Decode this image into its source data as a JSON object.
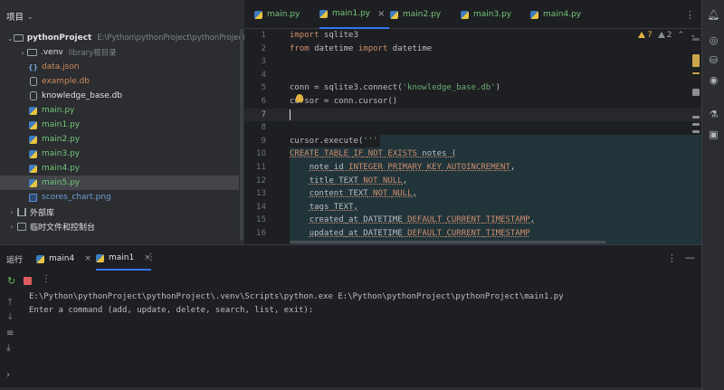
{
  "project_panel": {
    "title": "项目",
    "tree": [
      {
        "label": "pythonProject",
        "hint": "E:\\Python\\pythonProject\\pythonProject",
        "kind": "root"
      },
      {
        "label": ".venv",
        "hint": "library根目录",
        "kind": "folder"
      },
      {
        "label": "data.json",
        "kind": "json"
      },
      {
        "label": "example.db",
        "kind": "db"
      },
      {
        "label": "knowledge_base.db",
        "kind": "db-white"
      },
      {
        "label": "main.py",
        "kind": "py"
      },
      {
        "label": "main1.py",
        "kind": "py"
      },
      {
        "label": "main2.py",
        "kind": "py"
      },
      {
        "label": "main3.py",
        "kind": "py"
      },
      {
        "label": "main4.py",
        "kind": "py"
      },
      {
        "label": "main5.py",
        "kind": "py",
        "selected": true
      },
      {
        "label": "scores_chart.png",
        "kind": "png"
      },
      {
        "label": "外部库",
        "kind": "libs"
      },
      {
        "label": "临时文件和控制台",
        "kind": "scratches"
      }
    ]
  },
  "editor_tabs": [
    {
      "label": "main.py"
    },
    {
      "label": "main1.py",
      "active": true
    },
    {
      "label": "main2.py"
    },
    {
      "label": "main3.py"
    },
    {
      "label": "main4.py"
    }
  ],
  "inspections": {
    "warnings": "7",
    "weak_warnings": "2"
  },
  "code": {
    "line_numbers": [
      "1",
      "2",
      "3",
      "4",
      "5",
      "6",
      "7",
      "8",
      "9",
      "10",
      "11",
      "12",
      "13",
      "14",
      "15",
      "16"
    ],
    "current_line": "7",
    "lines": [
      "import sqlite3",
      "from datetime import datetime",
      "",
      "",
      "conn = sqlite3.connect('knowledge_base.db')",
      "cursor = conn.cursor()",
      "",
      "",
      "cursor.execute('''",
      "CREATE TABLE IF NOT EXISTS notes (",
      "    note_id INTEGER PRIMARY KEY AUTOINCREMENT,",
      "    title TEXT NOT NULL,",
      "    content TEXT NOT NULL,",
      "    tags TEXT,",
      "    created_at DATETIME DEFAULT CURRENT_TIMESTAMP,",
      "    updated_at DATETIME DEFAULT CURRENT_TIMESTAMP"
    ]
  },
  "run_panel": {
    "title": "运行",
    "tabs": [
      {
        "label": "main4"
      },
      {
        "label": "main1",
        "active": true
      }
    ],
    "console": [
      "E:\\Python\\pythonProject\\pythonProject\\.venv\\Scripts\\python.exe E:\\Python\\pythonProject\\pythonProject\\main1.py",
      "Enter a command (add, update, delete, search, list, exit):"
    ]
  },
  "colors": {
    "accent": "#3574f0",
    "python_file": "#74c67a",
    "db_file": "#d08a5e",
    "keyword": "#cf8e6d",
    "string": "#6aab73",
    "warning": "#e3b341",
    "stop": "#db5c5c",
    "sql_injection_bg": "#21343a"
  }
}
